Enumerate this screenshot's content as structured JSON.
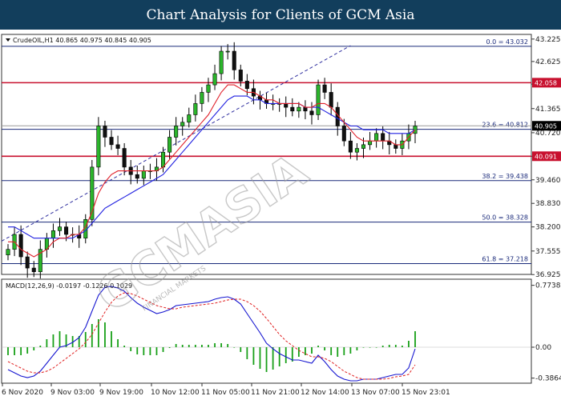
{
  "header": {
    "title": "Chart Analysis for Clients of GCM Asia"
  },
  "chart_data": {
    "type": "candlestick",
    "symbol_info": "CrudeOIL,H1  40.865 40.975 40.845 40.905",
    "price_axis_ticks": [
      "43.225",
      "42.625",
      "42.020",
      "41.365",
      "40.720",
      "40.090",
      "39.460",
      "38.830",
      "38.200",
      "37.555",
      "36.925"
    ],
    "time_axis_ticks": [
      "6 Nov 2020",
      "9 Nov 03:00",
      "9 Nov 19:00",
      "10 Nov 12:00",
      "11 Nov 05:00",
      "11 Nov 21:00",
      "12 Nov 14:00",
      "13 Nov 07:00",
      "15 Nov 23:01"
    ],
    "price_ylim": [
      36.93,
      43.35
    ],
    "fibonacci_levels": [
      {
        "label": "0.0 = 43.032",
        "price": 43.032
      },
      {
        "label": "23.6 = 40.812",
        "price": 40.812
      },
      {
        "label": "38.2 = 39.438",
        "price": 39.438
      },
      {
        "label": "50.0 = 38.328",
        "price": 38.328
      },
      {
        "label": "61.8 = 37.218",
        "price": 37.218
      }
    ],
    "red_levels": [
      {
        "label": "42.058",
        "price": 42.058
      },
      {
        "label": "40.091",
        "price": 40.091
      }
    ],
    "current_price_label": "40.905",
    "current_price": 40.905,
    "close_series": [
      37.6,
      38.0,
      37.4,
      37.1,
      37.0,
      37.6,
      37.9,
      38.1,
      38.2,
      38.0,
      38.0,
      37.9,
      38.4,
      39.8,
      40.9,
      40.6,
      40.4,
      40.3,
      39.8,
      39.6,
      39.5,
      39.7,
      39.7,
      39.8,
      40.2,
      40.6,
      40.9,
      41.0,
      41.2,
      41.5,
      41.8,
      42.0,
      42.3,
      42.9,
      42.9,
      42.4,
      42.1,
      41.9,
      41.7,
      41.6,
      41.5,
      41.5,
      41.5,
      41.4,
      41.3,
      41.4,
      41.3,
      41.2,
      42.0,
      41.8,
      41.4,
      40.9,
      40.5,
      40.2,
      40.3,
      40.4,
      40.5,
      40.7,
      40.5,
      40.4,
      40.3,
      40.5,
      40.7,
      40.9
    ],
    "red_ma": [
      37.8,
      37.8,
      37.6,
      37.5,
      37.4,
      37.5,
      37.6,
      37.8,
      37.9,
      37.9,
      38.0,
      38.0,
      38.2,
      38.6,
      39.1,
      39.4,
      39.6,
      39.7,
      39.7,
      39.7,
      39.7,
      39.7,
      39.7,
      39.7,
      39.8,
      40.0,
      40.2,
      40.4,
      40.6,
      40.8,
      41.0,
      41.2,
      41.5,
      41.8,
      42.0,
      42.0,
      41.9,
      41.8,
      41.8,
      41.7,
      41.6,
      41.6,
      41.5,
      41.5,
      41.5,
      41.5,
      41.4,
      41.4,
      41.5,
      41.5,
      41.4,
      41.2,
      41.0,
      40.8,
      40.6,
      40.5,
      40.5,
      40.5,
      40.5,
      40.5,
      40.4,
      40.4,
      40.6,
      40.8
    ],
    "blue_ma": [
      38.2,
      38.2,
      38.1,
      38.0,
      37.9,
      37.9,
      37.9,
      37.9,
      37.9,
      37.9,
      37.9,
      38.0,
      38.1,
      38.3,
      38.5,
      38.7,
      38.8,
      38.9,
      39.0,
      39.1,
      39.2,
      39.3,
      39.4,
      39.5,
      39.6,
      39.8,
      40.0,
      40.2,
      40.4,
      40.6,
      40.8,
      41.0,
      41.2,
      41.4,
      41.6,
      41.7,
      41.7,
      41.7,
      41.6,
      41.6,
      41.5,
      41.5,
      41.5,
      41.5,
      41.5,
      41.5,
      41.4,
      41.4,
      41.4,
      41.3,
      41.2,
      41.1,
      41.0,
      40.9,
      40.9,
      40.8,
      40.8,
      40.8,
      40.8,
      40.7,
      40.7,
      40.7,
      40.7,
      40.8
    ],
    "macd": {
      "info": "MACD(12,26,9) -0.0197 -0.1226 0.1029",
      "axis_ticks": [
        "0.7738",
        "0.00",
        "-0.3864"
      ],
      "ylim": [
        -0.45,
        0.85
      ],
      "macd_line": [
        -0.28,
        -0.32,
        -0.36,
        -0.38,
        -0.36,
        -0.3,
        -0.2,
        -0.1,
        0.0,
        0.02,
        0.06,
        0.12,
        0.25,
        0.45,
        0.65,
        0.75,
        0.76,
        0.74,
        0.7,
        0.62,
        0.55,
        0.5,
        0.46,
        0.42,
        0.44,
        0.47,
        0.52,
        0.53,
        0.54,
        0.55,
        0.56,
        0.57,
        0.6,
        0.62,
        0.63,
        0.6,
        0.54,
        0.42,
        0.3,
        0.18,
        0.05,
        -0.02,
        -0.08,
        -0.12,
        -0.16,
        -0.16,
        -0.18,
        -0.2,
        -0.1,
        -0.18,
        -0.28,
        -0.36,
        -0.4,
        -0.42,
        -0.42,
        -0.4,
        -0.4,
        -0.4,
        -0.38,
        -0.36,
        -0.34,
        -0.34,
        -0.26,
        -0.02
      ],
      "signal_line": [
        -0.18,
        -0.22,
        -0.26,
        -0.3,
        -0.32,
        -0.32,
        -0.3,
        -0.26,
        -0.2,
        -0.14,
        -0.08,
        -0.02,
        0.06,
        0.16,
        0.3,
        0.44,
        0.56,
        0.64,
        0.68,
        0.67,
        0.64,
        0.6,
        0.56,
        0.52,
        0.5,
        0.48,
        0.48,
        0.5,
        0.51,
        0.52,
        0.53,
        0.54,
        0.55,
        0.57,
        0.59,
        0.6,
        0.6,
        0.57,
        0.52,
        0.45,
        0.36,
        0.26,
        0.16,
        0.08,
        0.02,
        -0.04,
        -0.08,
        -0.12,
        -0.12,
        -0.14,
        -0.18,
        -0.24,
        -0.3,
        -0.34,
        -0.38,
        -0.4,
        -0.4,
        -0.4,
        -0.4,
        -0.39,
        -0.37,
        -0.36,
        -0.34,
        -0.22
      ],
      "histogram": [
        -0.1,
        -0.1,
        -0.1,
        -0.08,
        -0.04,
        0.02,
        0.1,
        0.16,
        0.2,
        0.16,
        0.14,
        0.14,
        0.19,
        0.29,
        0.35,
        0.31,
        0.2,
        0.1,
        0.02,
        -0.05,
        -0.09,
        -0.1,
        -0.1,
        -0.1,
        -0.06,
        -0.01,
        0.04,
        0.03,
        0.03,
        0.03,
        0.03,
        0.03,
        0.05,
        0.05,
        0.04,
        0.0,
        -0.06,
        -0.15,
        -0.22,
        -0.27,
        -0.31,
        -0.28,
        -0.24,
        -0.2,
        -0.18,
        -0.12,
        -0.1,
        -0.08,
        0.02,
        -0.04,
        -0.1,
        -0.12,
        -0.1,
        -0.08,
        -0.04,
        0.0,
        0.0,
        0.0,
        0.02,
        0.03,
        0.03,
        0.02,
        0.08,
        0.2
      ]
    }
  },
  "watermark": {
    "brand": "GCMASIA",
    "sub": "FINANCIAL MARKETS"
  },
  "colors": {
    "header_bg": "#123e5c",
    "fib_line": "#1a2a7a",
    "red_line": "#c8102e",
    "blue_ma": "#2020e0",
    "red_ma": "#e0202a",
    "macd_line": "#1515d0",
    "signal_line": "#e02020",
    "histogram": "#18a018",
    "current_tag": "#000000"
  }
}
